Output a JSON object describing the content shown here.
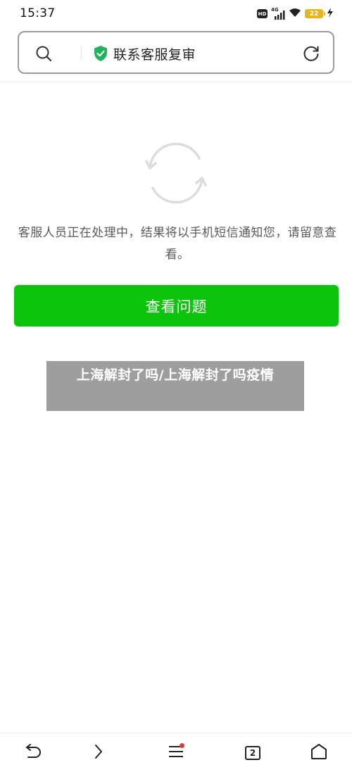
{
  "status_bar": {
    "time": "15:37",
    "hd_label": "HD",
    "network_label": "4G",
    "battery_level": "22",
    "icons": [
      "hd-icon",
      "signal-4g-icon",
      "wifi-icon",
      "battery-icon",
      "charging-icon"
    ]
  },
  "search_bar": {
    "title": "联系客服复审",
    "icons": [
      "search-icon",
      "shield-check-icon",
      "refresh-icon"
    ]
  },
  "main": {
    "loading_icon": "sync-icon",
    "message": "客服人员正在处理中，结果将以手机短信通知您，请留意查看。",
    "button_label": "查看问题"
  },
  "overlay": {
    "text": "上海解封了吗/上海解封了吗疫情"
  },
  "bottom_nav": {
    "tab_count": "2",
    "items": [
      "back-icon",
      "forward-icon",
      "menu-icon",
      "tabs-icon",
      "home-icon"
    ]
  },
  "colors": {
    "accent_green": "#0cc40c",
    "shield_green": "#20b35b",
    "battery": "#e8b61b",
    "notification_dot": "#e53935"
  }
}
